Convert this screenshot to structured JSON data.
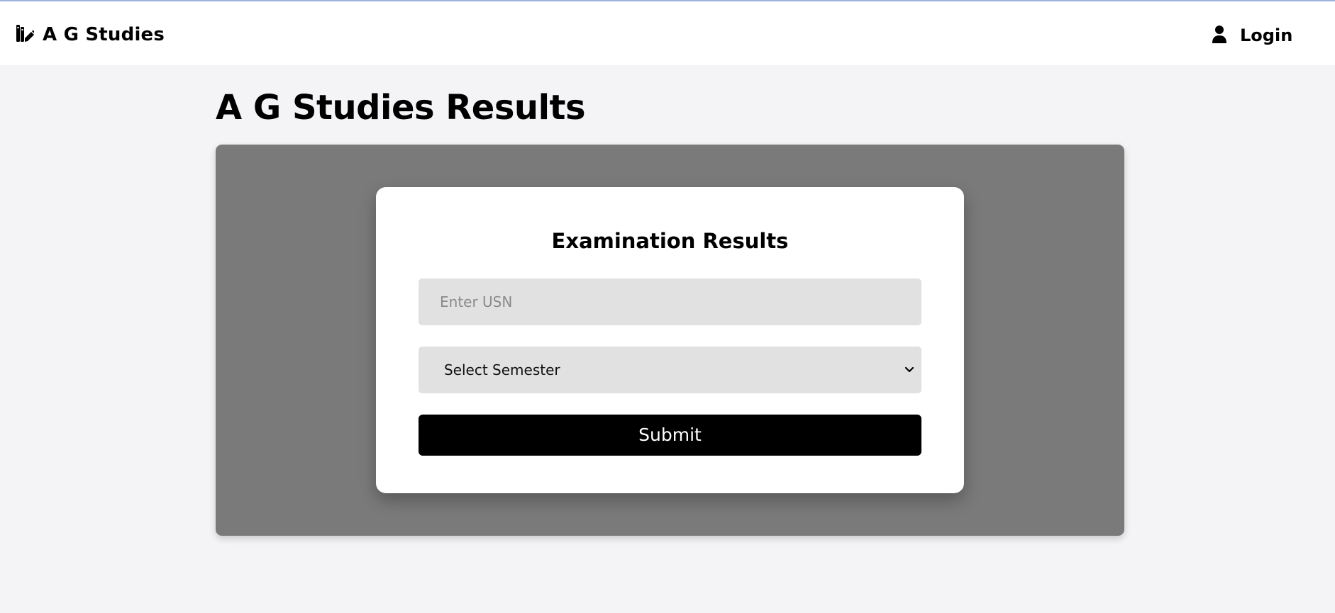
{
  "header": {
    "brand_name": "A G Studies",
    "brand_icon": "books-pencil-icon",
    "login_label": "Login",
    "login_icon": "user-icon"
  },
  "main": {
    "page_title": "A G Studies Results"
  },
  "form": {
    "title": "Examination Results",
    "usn_placeholder": "Enter USN",
    "usn_value": "",
    "semester_selected": "Select Semester",
    "submit_label": "Submit"
  },
  "colors": {
    "page_background": "#f4f4f6",
    "panel_background": "#7a7a7a",
    "card_background": "#ffffff",
    "input_background": "#e1e1e1",
    "button_background": "#000000",
    "button_text": "#ffffff"
  }
}
